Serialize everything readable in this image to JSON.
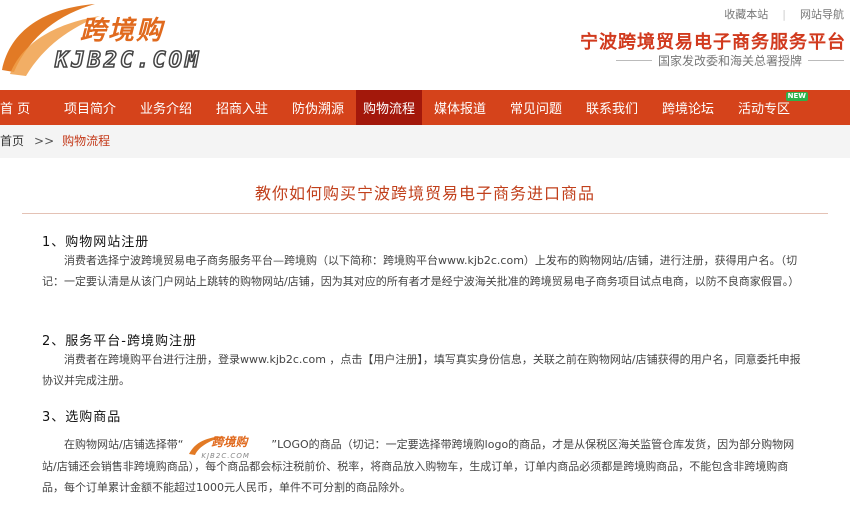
{
  "header": {
    "logo_cn": "跨境购",
    "logo_en": "KJB2C.COM",
    "links": [
      "收藏本站",
      "网站导航"
    ],
    "site_title": "宁波跨境贸易电子商务服务平台",
    "site_subtitle": "国家发改委和海关总署授牌"
  },
  "nav": {
    "items": [
      "首 页",
      "项目简介",
      "业务介绍",
      "招商入驻",
      "防伪溯源",
      "购物流程",
      "媒体报道",
      "常见问题",
      "联系我们",
      "跨境论坛",
      "活动专区"
    ],
    "active_index": 5,
    "new_badge": "NEW"
  },
  "breadcrumb": {
    "home": "首页",
    "separator": ">>",
    "current": "购物流程"
  },
  "article": {
    "title": "教你如何购买宁波跨境贸易电子商务进口商品",
    "sections": [
      {
        "heading": "1、购物网站注册",
        "paragraph": "消费者选择宁波跨境贸易电子商务服务平台—跨境购（以下简称：跨境购平台www.kjb2c.com）上发布的购物网站/店铺，进行注册，获得用户名。（切记：一定要认清是从该门户网站上跳转的购物网站/店铺，因为其对应的所有者才是经宁波海关批准的跨境贸易电子商务项目试点电商，以防不良商家假冒。）"
      },
      {
        "heading": "2、服务平台-跨境购注册",
        "paragraph": "消费者在跨境购平台进行注册，登录www.kjb2c.com ，点击【用户注册】，填写真实身份信息，关联之前在购物网站/店铺获得的用户名，同意委托申报协议并完成注册。"
      },
      {
        "heading": "3、选购商品",
        "paragraph_before": "在购物网站/店铺选择带“",
        "paragraph_after": "”LOGO的商品（切记：一定要选择带跨境购logo的商品，才是从保税区海关监管仓库发货，因为部分购物网站/店铺还会销售非跨境购商品），每个商品都会标注税前价、税率，将商品放入购物车，生成订单，订单内商品必须都是跨境购商品，不能包含非跨境购商品，每个订单累计金额不能超过1000元人民币，单件不可分割的商品除外。",
        "inline_logo_cn": "跨境购",
        "inline_logo_en": "KJB2C.COM"
      }
    ]
  },
  "colors": {
    "nav_bg": "#d5431b",
    "nav_active": "#a3180b",
    "title_red": "#d13a1e",
    "brand_orange": "#e06a1e"
  }
}
